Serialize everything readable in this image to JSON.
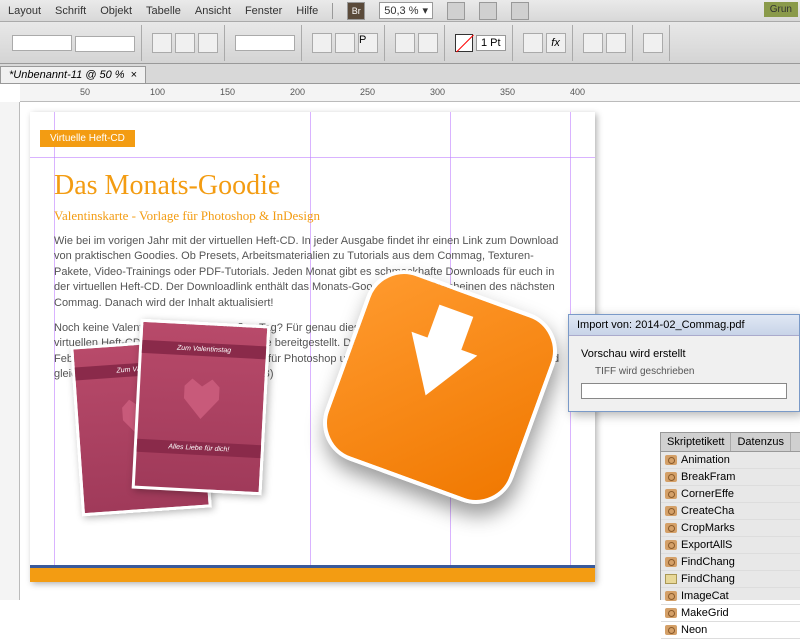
{
  "menu": {
    "items": [
      "Layout",
      "Schrift",
      "Objekt",
      "Tabelle",
      "Ansicht",
      "Fenster",
      "Hilfe"
    ],
    "zoom": "50,3 %",
    "right": "Grun"
  },
  "tab": {
    "label": "*Unbenannt-11 @ 50 %",
    "close": "×"
  },
  "ruler": {
    "ticks": [
      "50",
      "100",
      "150",
      "200",
      "250",
      "300",
      "350",
      "400"
    ]
  },
  "doc": {
    "badge": "Virtuelle Heft-CD",
    "headline": "Das Monats-Goodie",
    "subhead": "Valentinskarte - Vorlage für Photoshop & InDesign",
    "body1": "Wie bei im vorigen Jahr mit der virtuellen Heft-CD. In jeder Ausgabe findet ihr einen Link zum Download von praktischen Goodies. Ob Presets, Arbeitsmaterialien zu Tutorials aus dem Commag, Texturen-Pakete, Video-Trainings oder PDF-Tutorials. Jeden Monat gibt es schmackhafte Downloads für euch in der virtuellen Heft-CD. Der Downloadlink enthält das Monats-Goodie bis zum Erscheinen des nächsten Commag. Danach wird der Inhalt aktualisiert!",
    "body2": "Noch keine Valentinskarte für den großen Tag? Für genau diesen Fall haben wir euch in unserer 37. virtuellen Heft-CD eine große solche Vorlage bereitgestellt. Damit ihr nicht mit leeren Händen am 14. Februar dasteht, könnt ihr euch die Vorlage für Photoshop und InDesign nun kostenlos downloaden und gleich anpassen. Zum Download (ca. 22 MB)",
    "ribbon1": "Zum Valentin",
    "ribbon2": "Zum Valentinstag",
    "ribbon3": "Alles Liebe für dich!"
  },
  "toolbar": {
    "stroke": "1 Pt"
  },
  "dialog": {
    "title": "Import von: 2014-02_Commag.pdf",
    "status": "Vorschau wird erstellt",
    "substatus": "TIFF wird geschrieben"
  },
  "panel": {
    "tabs": [
      "Skriptetikett",
      "Datenzus"
    ],
    "items": [
      {
        "icon": "script",
        "label": "Animation"
      },
      {
        "icon": "script",
        "label": "BreakFram"
      },
      {
        "icon": "script",
        "label": "CornerEffe"
      },
      {
        "icon": "script",
        "label": "CreateCha"
      },
      {
        "icon": "script",
        "label": "CropMarks"
      },
      {
        "icon": "script",
        "label": "ExportAllS"
      },
      {
        "icon": "script",
        "label": "FindChang"
      },
      {
        "icon": "folder",
        "label": "FindChang"
      },
      {
        "icon": "script",
        "label": "ImageCat"
      },
      {
        "icon": "script",
        "label": "MakeGrid"
      },
      {
        "icon": "script",
        "label": "Neon"
      }
    ]
  }
}
